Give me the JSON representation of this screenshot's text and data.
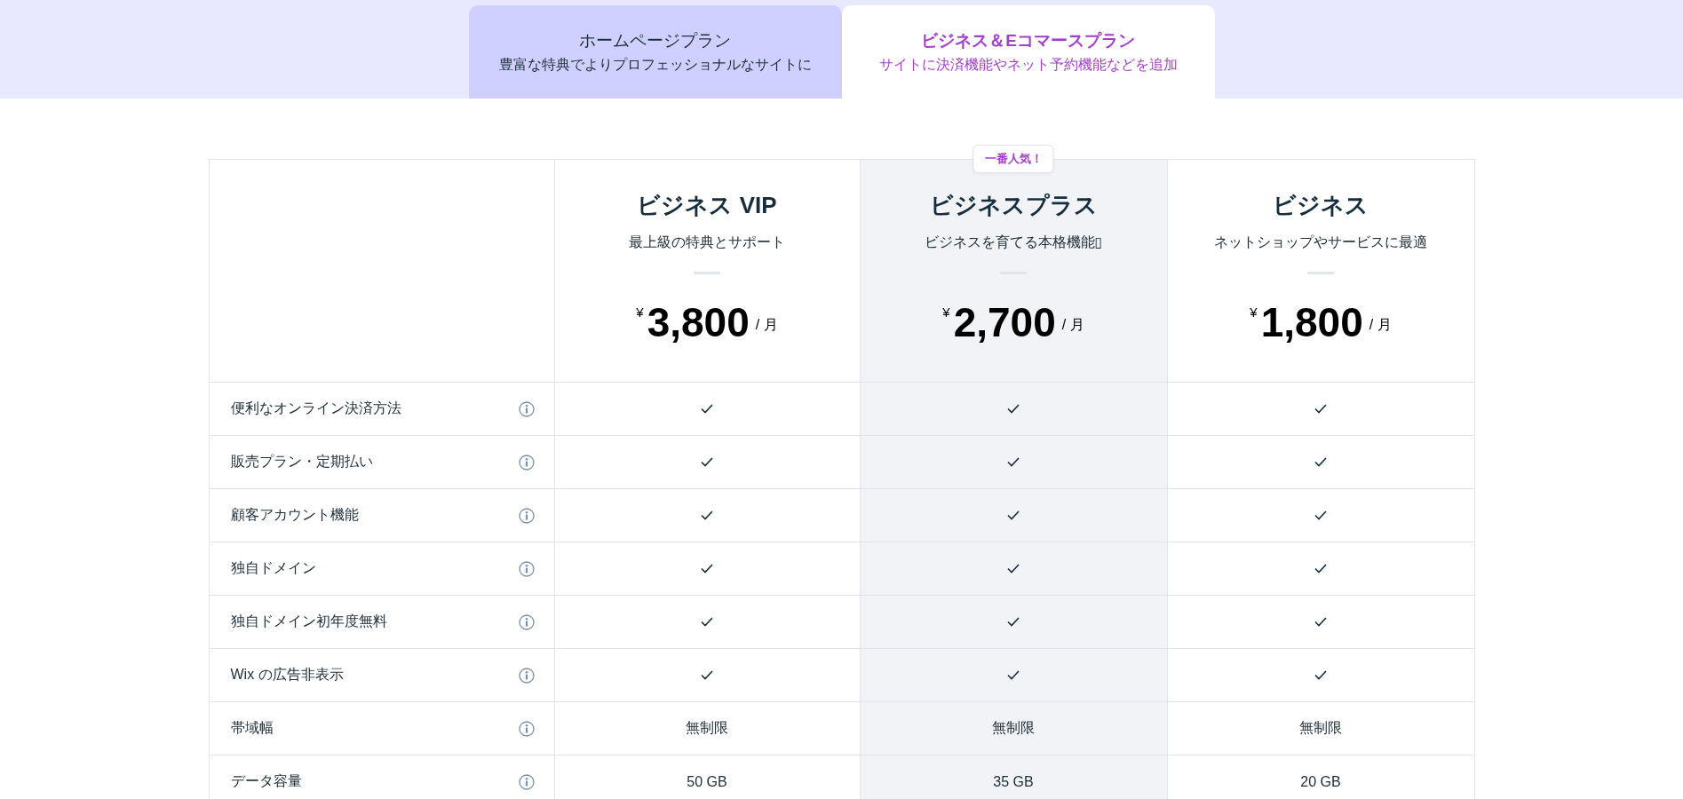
{
  "tabs": [
    {
      "title": "ホームページプラン",
      "subtitle": "豊富な特典でよりプロフェッショナルなサイトに",
      "selected": false
    },
    {
      "title": "ビジネス＆Eコマースプラン",
      "subtitle": "サイトに決済機能やネット予約機能などを追加",
      "selected": true
    }
  ],
  "plans": [
    {
      "name": "ビジネス VIP",
      "description": "最上級の特典とサポート",
      "currency": "¥",
      "price": "3,800",
      "period": "/ 月",
      "highlighted": false
    },
    {
      "name": "ビジネスプラス",
      "description": "ビジネスを育てる本格機能▯",
      "currency": "¥",
      "price": "2,700",
      "period": "/ 月",
      "highlighted": true,
      "badge": "一番人気！"
    },
    {
      "name": "ビジネス",
      "description": "ネットショップやサービスに最適",
      "currency": "¥",
      "price": "1,800",
      "period": "/ 月",
      "highlighted": false
    }
  ],
  "features": [
    {
      "label": "便利なオンライン決済方法",
      "cells": [
        {
          "kind": "check",
          "included": true
        },
        {
          "kind": "check",
          "included": true
        },
        {
          "kind": "check",
          "included": true
        }
      ]
    },
    {
      "label": "販売プラン・定期払い",
      "cells": [
        {
          "kind": "check",
          "included": true
        },
        {
          "kind": "check",
          "included": true
        },
        {
          "kind": "check",
          "included": true
        }
      ]
    },
    {
      "label": "顧客アカウント機能",
      "cells": [
        {
          "kind": "check",
          "included": true
        },
        {
          "kind": "check",
          "included": true
        },
        {
          "kind": "check",
          "included": true
        }
      ]
    },
    {
      "label": "独自ドメイン",
      "cells": [
        {
          "kind": "check",
          "included": true
        },
        {
          "kind": "check",
          "included": true
        },
        {
          "kind": "check",
          "included": true
        }
      ]
    },
    {
      "label": "独自ドメイン初年度無料",
      "cells": [
        {
          "kind": "check",
          "included": true
        },
        {
          "kind": "check",
          "included": true
        },
        {
          "kind": "check",
          "included": true
        }
      ]
    },
    {
      "label": "Wix の広告非表示",
      "cells": [
        {
          "kind": "check",
          "included": true
        },
        {
          "kind": "check",
          "included": true
        },
        {
          "kind": "check",
          "included": true
        }
      ]
    },
    {
      "label": "帯域幅",
      "cells": [
        {
          "kind": "text",
          "text": "無制限"
        },
        {
          "kind": "text",
          "text": "無制限"
        },
        {
          "kind": "text",
          "text": "無制限"
        }
      ]
    },
    {
      "label": "データ容量",
      "cells": [
        {
          "kind": "text",
          "text": "50 GB"
        },
        {
          "kind": "text",
          "text": "35 GB"
        },
        {
          "kind": "text",
          "text": "20 GB"
        }
      ]
    }
  ]
}
